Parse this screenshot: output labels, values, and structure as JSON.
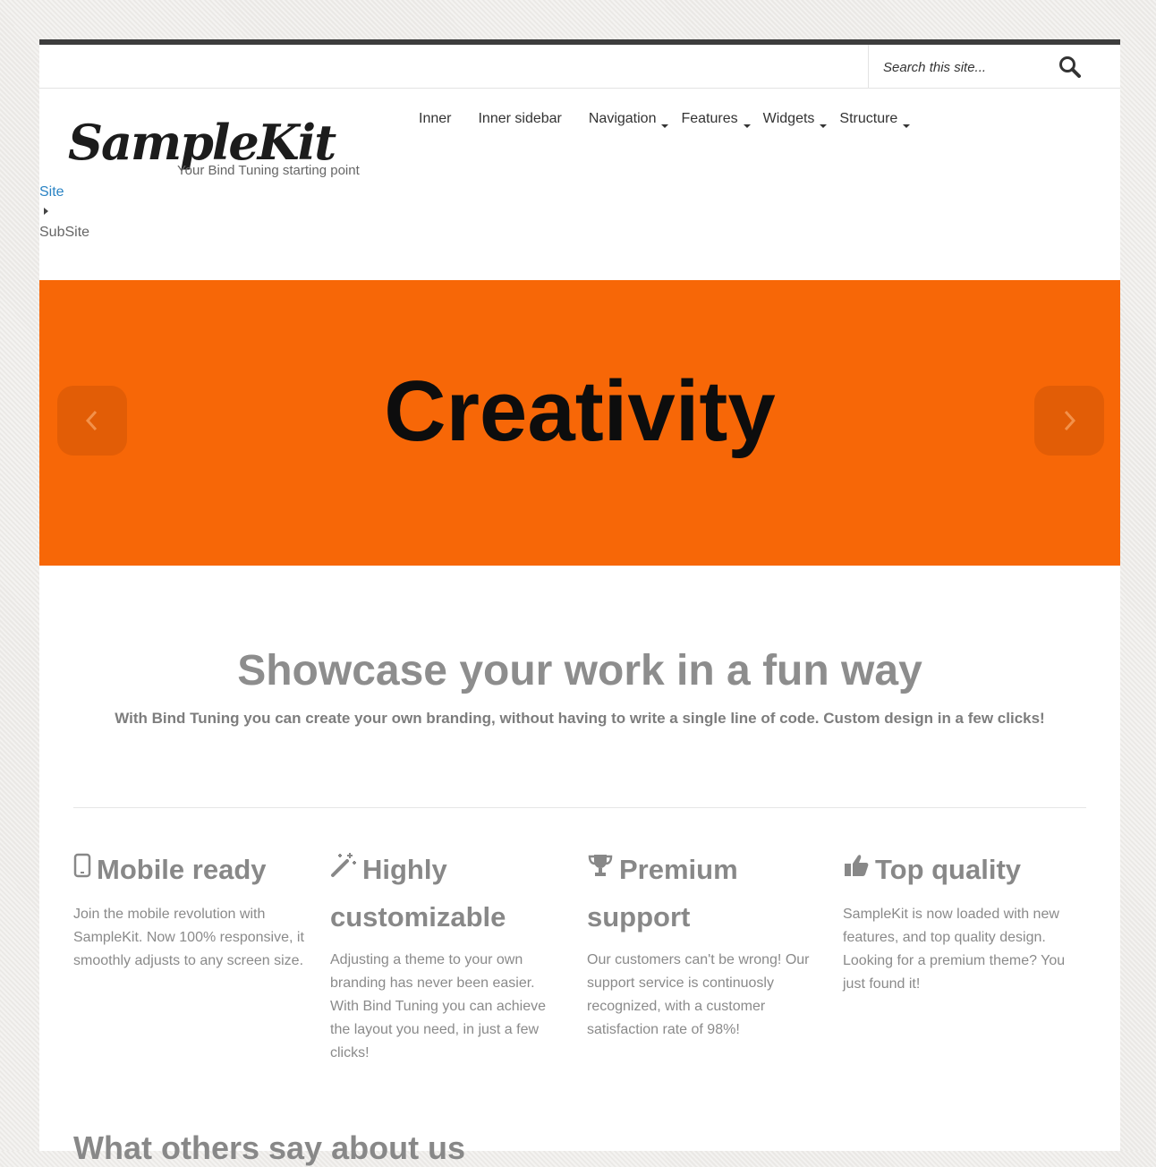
{
  "search": {
    "placeholder": "Search this site..."
  },
  "logo": {
    "name": "SampleKit",
    "tagline": "Your Bind Tuning starting point"
  },
  "nav": {
    "items": [
      {
        "label": "Inner",
        "dropdown": false
      },
      {
        "label": "Inner sidebar",
        "dropdown": false
      },
      {
        "label": "Navigation",
        "dropdown": true
      },
      {
        "label": "Features",
        "dropdown": true
      },
      {
        "label": "Widgets",
        "dropdown": true
      },
      {
        "label": "Structure",
        "dropdown": true
      }
    ]
  },
  "breadcrumb": {
    "site": "Site",
    "subsite": "SubSite"
  },
  "hero": {
    "title": "Creativity",
    "background": "#f76707",
    "prev_icon": "chevron-left-icon",
    "next_icon": "chevron-right-icon"
  },
  "showcase": {
    "title": "Showcase your work in a fun way",
    "subtitle": "With Bind Tuning you can create your own branding, without having to write a single line of code. Custom design in a few clicks!"
  },
  "features": [
    {
      "icon": "mobile-icon",
      "title": "Mobile ready",
      "text": "Join the mobile revolution with SampleKit. Now 100% responsive, it smoothly adjusts to any screen size."
    },
    {
      "icon": "magic-wand-icon",
      "title": "Highly customizable",
      "text": "Adjusting a theme to your own branding has never been easier. With Bind Tuning you can achieve the layout you need, in just a few clicks!"
    },
    {
      "icon": "trophy-icon",
      "title": "Premium support",
      "text": "Our customers can't be wrong! Our support service is continuosly recognized, with a customer satisfaction rate of 98%!"
    },
    {
      "icon": "thumbs-up-icon",
      "title": "Top quality",
      "text": "SampleKit is now loaded with new features, and top quality design. Looking for a premium theme? You just found it!"
    }
  ],
  "testimonials": {
    "title": "What others say about us"
  }
}
